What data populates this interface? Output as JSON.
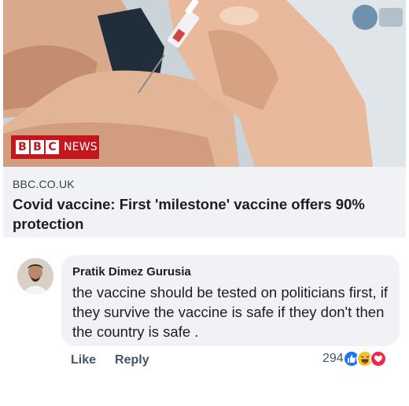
{
  "link_preview": {
    "image_alt": "Vaccine injection into upper arm",
    "logo": {
      "letters": [
        "B",
        "B",
        "C"
      ],
      "suffix": "NEWS",
      "color": "#c4161c"
    },
    "domain": "BBC.CO.UK",
    "headline": "Covid vaccine: First 'milestone' vaccine offers 90% protection"
  },
  "comment": {
    "author": "Pratik Dimez Gurusia",
    "text": "the vaccine should be tested on politicians first, if they survive the vaccine is safe if they don't then the country is safe .",
    "actions": {
      "like": "Like",
      "reply": "Reply"
    },
    "reaction_count": "294",
    "reactions": [
      "like-icon",
      "haha-icon",
      "love-icon"
    ]
  },
  "colors": {
    "bubble_bg": "#f0f2f5",
    "action_text": "#44546f",
    "like_blue": "#1877f2",
    "haha_yellow": "#f7c12e",
    "love_red": "#f02849"
  }
}
